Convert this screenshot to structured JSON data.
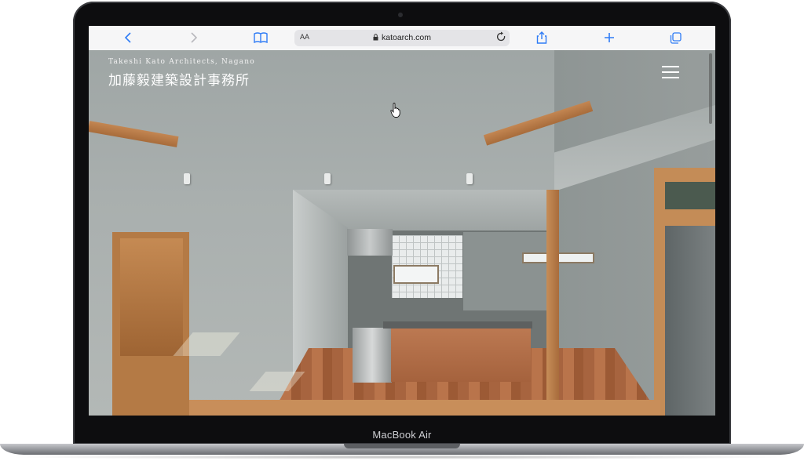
{
  "device": {
    "label": "MacBook Air"
  },
  "browser": {
    "text_size_label": "AA",
    "url": "katoarch.com",
    "icons": {
      "back": "chevron-left-icon",
      "forward": "chevron-right-icon",
      "bookmarks": "book-icon",
      "lock": "lock-icon",
      "reload": "reload-icon",
      "share": "share-icon",
      "new_tab": "plus-icon",
      "tabs": "tabs-icon"
    }
  },
  "site": {
    "name_en": "Takeshi Kato Architects, Nagano",
    "name_jp": "加藤毅建築設計事務所",
    "menu_icon": "hamburger-menu-icon"
  },
  "colors": {
    "toolbar_bg": "#f6f6f7",
    "accent_blue": "#2f7cf6",
    "frame": "#0d0d0f"
  }
}
